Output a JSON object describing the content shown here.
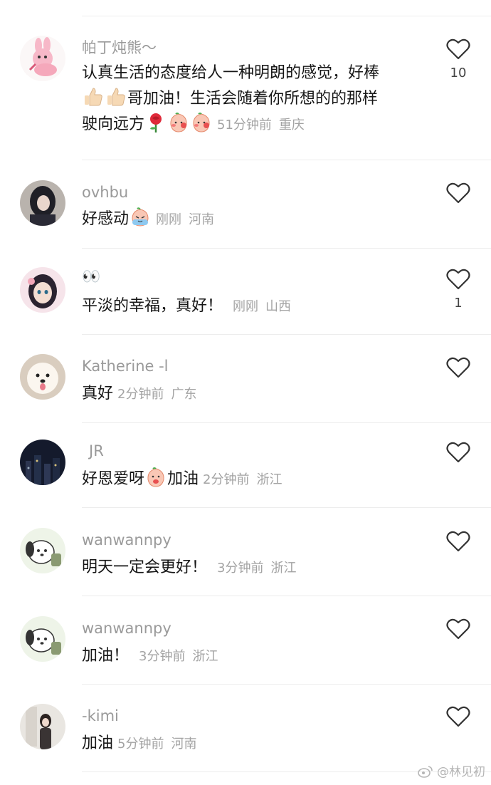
{
  "comments": [
    {
      "username": "帕丁炖熊～",
      "text_lines": [
        "认真生活的态度给人一种明朗的感觉，好棒",
        "哥加油！生活会随着你所想的的那样",
        "驶向远方"
      ],
      "time": "51分钟前",
      "region": "重庆",
      "likes": "10",
      "emoji_row2_lead": [
        "thumbs-up",
        "thumbs-up"
      ],
      "emoji_row3": [
        "rose",
        "peach-cheek",
        "peach-cheek"
      ]
    },
    {
      "username": "ovhbu",
      "text": "好感动",
      "emoji": [
        "crying-peach"
      ],
      "time": "刚刚",
      "region": "河南",
      "likes": ""
    },
    {
      "username": "👀",
      "text": "平淡的幸福，真好！",
      "time": "刚刚",
      "region": "山西",
      "likes": "1"
    },
    {
      "username": "Katherine -l",
      "text": "真好",
      "time": "2分钟前",
      "region": "广东",
      "likes": ""
    },
    {
      "username": "JR",
      "text_a": "好恩爱呀",
      "text_b": "加油",
      "emoji": [
        "peach-blush"
      ],
      "time": "2分钟前",
      "region": "浙江",
      "likes": ""
    },
    {
      "username": "wanwannpy",
      "text": "明天一定会更好！",
      "time": "3分钟前",
      "region": "浙江",
      "likes": ""
    },
    {
      "username": "wanwannpy",
      "text": "加油！",
      "time": "3分钟前",
      "region": "浙江",
      "likes": ""
    },
    {
      "username": "-kimi",
      "text": "加油",
      "time": "5分钟前",
      "region": "河南",
      "likes": ""
    }
  ],
  "watermark": "@林见初",
  "colors": {
    "username": "#9a9a9a",
    "meta": "#a3a3a3",
    "divider": "#ededed",
    "heart": "#333333"
  }
}
